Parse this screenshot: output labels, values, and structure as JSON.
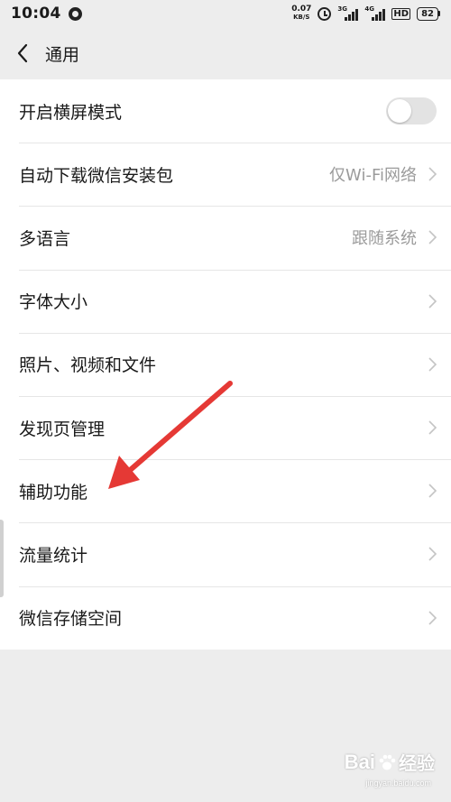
{
  "status_bar": {
    "time": "10:04",
    "net_speed_value": "0.07",
    "net_speed_unit": "KB/S",
    "sim1_label": "3G",
    "sim2_label": "4G",
    "hd_label": "HD",
    "battery_level": "82"
  },
  "header": {
    "title": "通用"
  },
  "settings": {
    "items": [
      {
        "label": "开启横屏模式",
        "value": "",
        "toggle_on": false
      },
      {
        "label": "自动下载微信安装包",
        "value": "仅Wi-Fi网络"
      },
      {
        "label": "多语言",
        "value": "跟随系统"
      },
      {
        "label": "字体大小",
        "value": ""
      },
      {
        "label": "照片、视频和文件",
        "value": ""
      },
      {
        "label": "发现页管理",
        "value": ""
      },
      {
        "label": "辅助功能",
        "value": ""
      },
      {
        "label": "流量统计",
        "value": ""
      },
      {
        "label": "微信存储空间",
        "value": ""
      }
    ]
  },
  "annotation": {
    "arrow_color": "#e53935"
  },
  "watermark": {
    "brand": "Bai",
    "suffix": "经验",
    "url": "jingyan.baidu.com"
  },
  "colors": {
    "background": "#ededed",
    "list_background": "#ffffff",
    "secondary_text": "#9b9b9b"
  }
}
